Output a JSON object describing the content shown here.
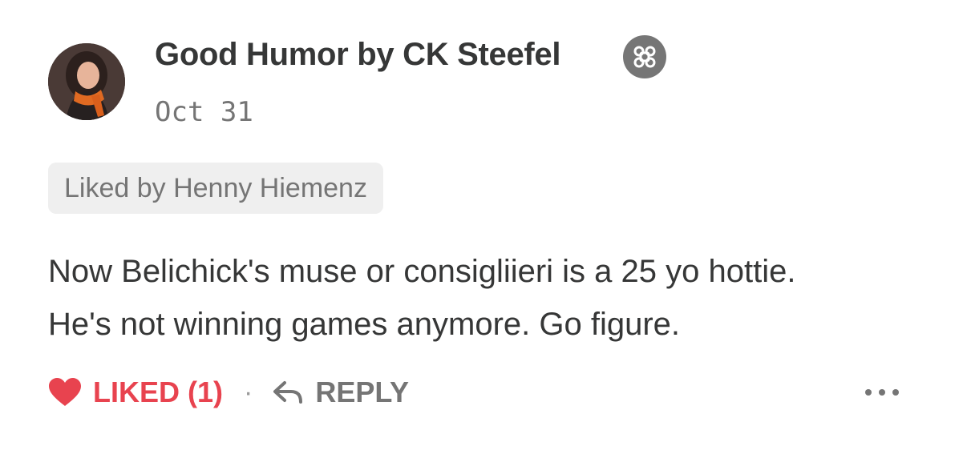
{
  "comment": {
    "author": "Good Humor by CK Steefel",
    "badge_icon": "subscriber-flower-icon",
    "date": "Oct 31",
    "liked_by": "Liked by Henny Hiemenz",
    "body_lines": [
      "Now Belichick's muse or consigliieri is a 25 yo hottie.",
      "He's not winning games anymore. Go figure."
    ]
  },
  "actions": {
    "like_label": "LIKED (1)",
    "like_icon": "heart-icon",
    "separator": "·",
    "reply_label": "REPLY",
    "reply_icon": "reply-arrow-icon",
    "more_icon": "more-horizontal-icon"
  },
  "colors": {
    "liked": "#e8434f",
    "muted": "#757575",
    "text": "#363737",
    "pill_bg": "#efefef"
  }
}
